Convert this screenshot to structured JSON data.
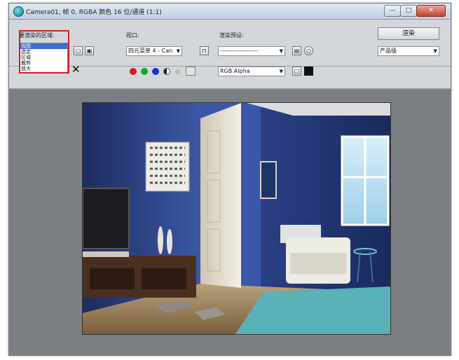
{
  "window": {
    "title": "Camera01, 帧 0, RGBA 颜色 16 位/通道 (1:1)",
    "minimize_glyph": "—",
    "maximize_glyph": "□",
    "close_glyph": "✕"
  },
  "toolbar": {
    "area_label": "要渲染的区域:",
    "area_value": "视图",
    "area_options": [
      "视图",
      "选定",
      "区域",
      "裁剪",
      "放大"
    ],
    "viewport_label": "视口:",
    "viewport_value": "四元菜单 4 - Can",
    "preset_label": "渲染预设:",
    "preset_value": "-------------------",
    "render_button": "渲染",
    "product_value": "产品级",
    "channel_value": "RGB Alpha",
    "combo_arrow": "▼",
    "clear_glyph": "✕"
  },
  "colors": {
    "red_channel": "#e0191b",
    "green_channel": "#16a62b",
    "blue_channel": "#1c2fd0",
    "highlight": "#cc1f24"
  }
}
